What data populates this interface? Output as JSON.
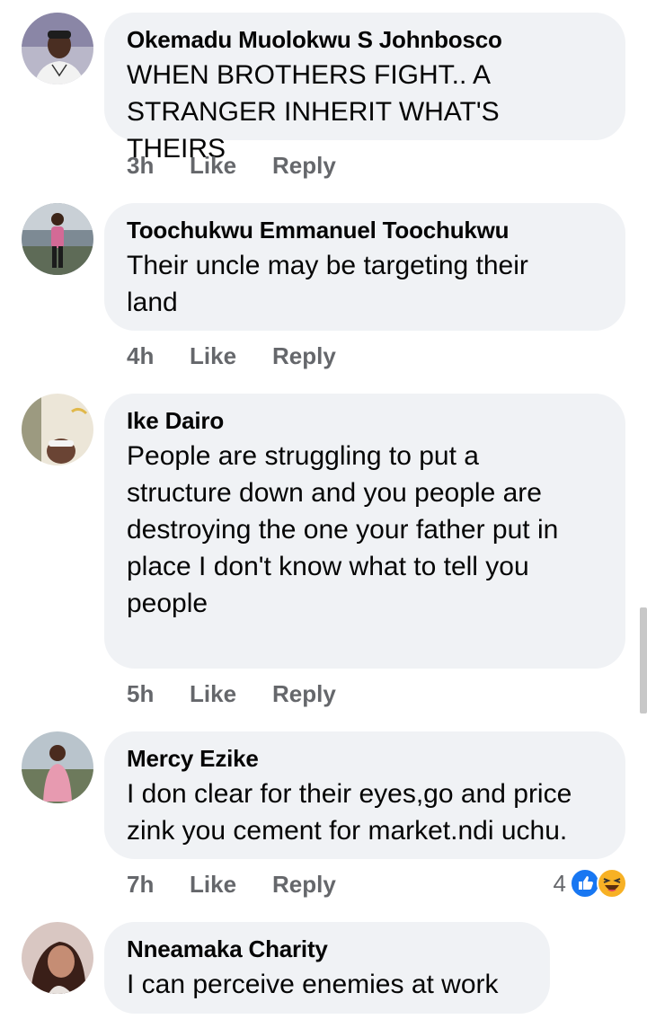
{
  "comments": [
    {
      "author": "Okemadu Muolokwu S Johnbosco",
      "text": "WHEN BROTHERS FIGHT.. A\nSTRANGER INHERIT WHAT'S THEIRS",
      "time": "3h",
      "like": "Like",
      "reply": "Reply"
    },
    {
      "author": "Toochukwu Emmanuel Toochukwu",
      "text": "Their uncle may be targeting their\nland",
      "time": "4h",
      "like": "Like",
      "reply": "Reply"
    },
    {
      "author": "Ike Dairo",
      "text": "People are struggling to put a\nstructure down and you people are\ndestroying the one your father put in\nplace I don't know what to tell you\npeople",
      "time": "5h",
      "like": "Like",
      "reply": "Reply"
    },
    {
      "author": "Mercy Ezike",
      "text": "I don clear for their eyes,go and price\nzink you cement for market.ndi uchu.",
      "time": "7h",
      "like": "Like",
      "reply": "Reply",
      "reaction_count": "4",
      "reactions": [
        "like-reaction-icon",
        "haha-reaction-icon"
      ]
    },
    {
      "author": "Nneamaka Charity",
      "text": "I can perceive enemies at work"
    }
  ],
  "colors": {
    "bubble": "#f0f2f5",
    "meta": "#65676b",
    "like_blue": "#1877f2",
    "haha_yellow": "#f7b125"
  }
}
